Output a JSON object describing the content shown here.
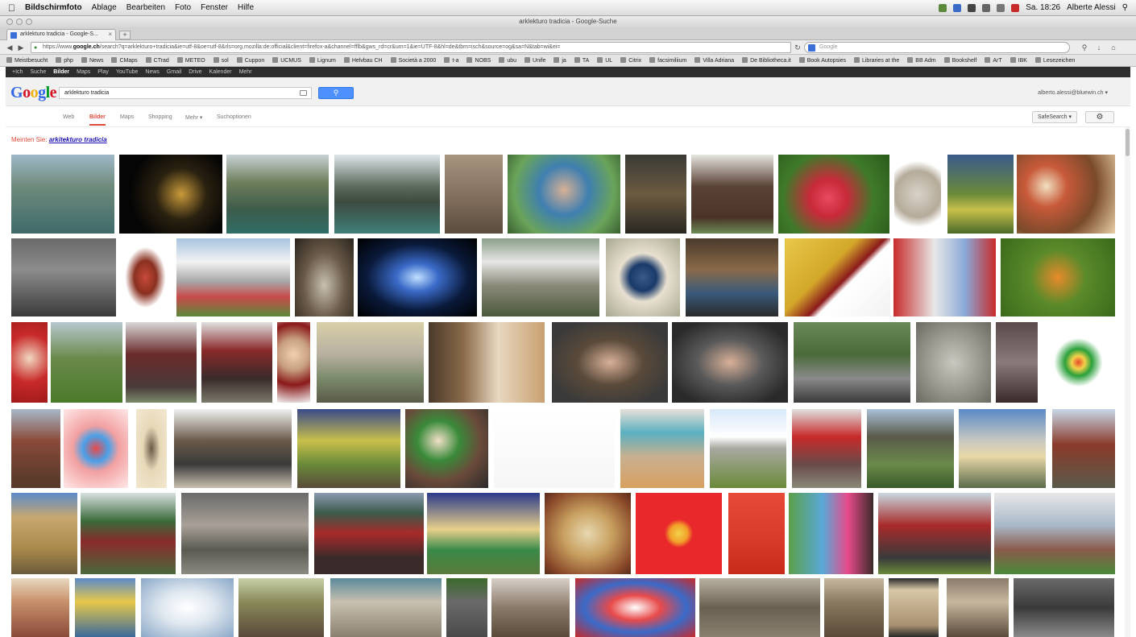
{
  "menubar": {
    "app": "Bildschirmfoto",
    "items": [
      "Ablage",
      "Bearbeiten",
      "Foto",
      "Fenster",
      "Hilfe"
    ],
    "clock": "Sa. 18:26",
    "user": "Alberte Alessi"
  },
  "window": {
    "title": "arklekturo tradicia - Google-Suche"
  },
  "browser": {
    "tab_title": "arklekturo tradicia - Google-S...",
    "url_prefix": "https://www.",
    "url_domain": "google.ch",
    "url_rest": "/search?q=arklekturo+tradicia&ie=utf-8&oe=utf-8&rls=org.mozilla:de:official&client=firefox-a&channel=fflb&gws_rd=cr&um=1&ie=UTF-8&hl=de&tbm=isch&source=og&sa=N&tab=wi&ei=",
    "search_placeholder": "Google"
  },
  "bookmarks": [
    "Meistbesucht",
    "php",
    "News",
    "CMaps",
    "CTrad",
    "METEO",
    "sol",
    "Cuppon",
    "UCMUS",
    "Lignum",
    "Helvbau CH",
    "Società a 2000",
    "t-a",
    "NOBS",
    "ubu",
    "Unife",
    "ja",
    "TA",
    "UL",
    "Citrix",
    "facsimiliium",
    "Villa Adriana",
    "De Bibliotheca.it",
    "Book Autopsies",
    "Libraries at the",
    "BB Adm",
    "Bookshelf",
    "ArT",
    "IBK",
    "Lesezeichen"
  ],
  "google_bar": [
    "+Ich",
    "Suche",
    "Bilder",
    "Maps",
    "Play",
    "YouTube",
    "News",
    "Gmail",
    "Drive",
    "Kalender",
    "Mehr"
  ],
  "google_bar_active": 2,
  "search": {
    "query": "arklekturo tradicia",
    "button_icon": "search-icon",
    "user_email": "alberto.alessi@bluewin.ch"
  },
  "tools": {
    "items": [
      "Web",
      "Bilder",
      "Maps",
      "Shopping",
      "Mehr",
      "Suchoptionen"
    ],
    "active": 1,
    "safe_search": "SafeSearch",
    "settings_icon": "gear-icon"
  },
  "did_you_mean": {
    "prefix": "Meinten Sie:",
    "suggestion": "arkitekturo tradicia"
  },
  "colors": {
    "accent_blue": "#4d90fe",
    "google_red": "#dd4b39",
    "link": "#1a0dab"
  },
  "thumbnails": [
    {
      "bg": "linear-gradient(180deg,#9fb8c8 0%,#6f8b7c 40%,#3f6a6a 100%)"
    },
    {
      "bg": "radial-gradient(circle at 60% 50%,#c99a3a 0%,#2a2110 35%,#050505 70%)"
    },
    {
      "bg": "linear-gradient(180deg,#c8d2d6 0%,#6f7f5d 35%,#3c5b4a 70%,#2f6e66 100%)"
    },
    {
      "bg": "linear-gradient(180deg,#dfe6ea 0%,#5b6b5d 40%,#3d4a40 60%,#3f7f78 100%)"
    },
    {
      "bg": "linear-gradient(180deg,#a89580 0%,#7d6a58 60%,#5a4c3f 100%)"
    },
    {
      "bg": "radial-gradient(circle at 50% 45%,#d8b095 0%,#3f7fb0 35%,#6aa45a 70%,#3a6030 100%)"
    },
    {
      "bg": "linear-gradient(180deg,#3b3a36 0%,#6b5b40 50%,#2a2722 100%)"
    },
    {
      "bg": "linear-gradient(180deg,#e6e6e0 0%,#5a4236 40%,#4a3428 80%,#6c8a55 100%)"
    },
    {
      "bg": "radial-gradient(circle at 45% 55%,#e84a5f 0%,#c82a3a 25%,#3f7a2a 60%,#2a5a1a 100%)"
    },
    {
      "bg": "radial-gradient(circle,#d8d2c8 0%,#b5ab9a 50%,#ffffff 72%)"
    },
    {
      "bg": "linear-gradient(180deg,#3a5a8a 0%,#6a8a3a 50%,#c8c04a 70%,#4a6a2a 100%)"
    },
    {
      "bg": "radial-gradient(circle at 30% 40%,#f0e0c0 0%,#c85a3a 25%,#7a4a2a 60%,#e8d0a8 100%)"
    },
    {
      "bg": "linear-gradient(180deg,#6a6a6a 0%,#8c8c8c 40%,#3a3a3a 100%)"
    },
    {
      "bg": "radial-gradient(ellipse at 50% 50%,#c84a3a 0%,#8a3020 30%,#ffffff 55%)"
    },
    {
      "bg": "linear-gradient(180deg,#a8c4e0 0%,#f2f2f2 30%,#a8a8a8 55%,#c84a4a 75%,#5a8a3a 100%)"
    },
    {
      "bg": "radial-gradient(ellipse at 50% 60%,#c8c0b0 0%,#6a5a48 50%,#2a241d 100%)"
    },
    {
      "bg": "radial-gradient(ellipse at 50% 50%,#c0e0ff 0%,#3a6ac8 25%,#0a1a3a 60%,#000000 100%)"
    },
    {
      "bg": "linear-gradient(180deg,#8aa08a 0%,#e6e6e6 30%,#8a8a7a 60%,#4a5a3a 100%)"
    },
    {
      "bg": "radial-gradient(circle at 50% 50%,#3a5a8a 0%,#1a3a6a 25%,#e8e0d0 45%,#a8a890 100%)"
    },
    {
      "bg": "linear-gradient(180deg,#4a3a2a 0%,#8a6a4a 40%,#3a5a7a 70%,#2a2a2a 100%)"
    },
    {
      "bg": "linear-gradient(135deg,#e8c84a 0%,#d4a82a 40%,#8a1a1a 55%,#ffffff 60%,#f2f2f2 100%)"
    },
    {
      "bg": "linear-gradient(90deg,#c82a2a 0%,#e8e8e8 40%,#8aa8d8 70%,#c82a2a 100%)"
    },
    {
      "bg": "radial-gradient(circle at 50% 50%,#e88a2a 0%,#5a8a2a 40%,#3a6a1a 100%)"
    },
    {
      "bg": "radial-gradient(circle at 50% 45%,#f0d8c0 0%,#c82a2a 50%,#a01a1a 100%)"
    },
    {
      "bg": "linear-gradient(180deg,#b8c8d0 0%,#6a8a4a 45%,#4a7a2a 100%)"
    },
    {
      "bg": "linear-gradient(180deg,#d8d8d8 0%,#6a2a2a 40%,#4a3a3a 80%,#7a8a6a 100%)"
    },
    {
      "bg": "linear-gradient(180deg,#e0e0e0 0%,#8a2a2a 35%,#3a2a2a 70%,#7a7a6a 100%)"
    },
    {
      "bg": "radial-gradient(circle at 50% 40%,#f0d0b0 0%,#c8a080 30%,#8a1a1a 60%,#f2f2f2 100%)"
    },
    {
      "bg": "linear-gradient(180deg,#d8d0a8 0%,#b8b0a0 40%,#7a8a6a 70%,#5a5a48 100%)"
    },
    {
      "bg": "linear-gradient(90deg,#4a3a2a 0%,#8a6a4a 30%,#e8d8c0 60%,#c8a070 100%)"
    },
    {
      "bg": "radial-gradient(ellipse at 50% 50%,#d8b098 0%,#5a4a3a 40%,#3a3a3a 80%)"
    },
    {
      "bg": "radial-gradient(ellipse at 50% 50%,#d8b098 0%,#5a5a5a 40%,#2a2a2a 80%)"
    },
    {
      "bg": "linear-gradient(180deg,#6a8a5a 0%,#4a6a3a 40%,#8a8a8a 70%,#3a3a3a 100%)"
    },
    {
      "bg": "radial-gradient(ellipse at 50% 50%,#c8c8c0 0%,#9a9a90 50%,#6a6a62 100%)"
    },
    {
      "bg": "linear-gradient(180deg,#5a4a4a 0%,#8a7a7a 50%,#3a2a2a 100%)"
    },
    {
      "bg": "radial-gradient(circle at 50% 50%,#e84a2a 0%,#f2d24a 12%,#2aa03a 25%,#ffffff 45%)"
    },
    {
      "bg": "linear-gradient(180deg,#a8b8c8 0%,#8a4a3a 40%,#5a3a2a 90%)"
    },
    {
      "bg": "radial-gradient(circle at 50% 50%,#e84a4a 0%,#4aa0e8 25%,#f2a0a0 45%,#ffe8e8 100%)"
    },
    {
      "bg": "radial-gradient(ellipse at 50% 50%,#6a5a48 0%,#e8d8b8 40%,#f2e8d0 100%)"
    },
    {
      "bg": "linear-gradient(180deg,#f0f0f0 0%,#6a5a4a 40%,#3a3a3a 70%,#c8c0b0 100%)"
    },
    {
      "bg": "linear-gradient(180deg,#3a4a8a 0%,#c8c04a 40%,#6a8a3a 70%,#5a4a3a 100%)"
    },
    {
      "bg": "radial-gradient(ellipse at 40% 40%,#f2e0c8 0%,#3a8a3a 30%,#6a4a3a 60%,#2a2a2a 100%)"
    },
    {
      "bg": "linear-gradient(180deg,#ffffff 0%,#f6f6f6 100%)"
    },
    {
      "bg": "linear-gradient(180deg,#e8e0d8 0%,#5ab0c0 30%,#c8b090 60%,#d8a060 100%)"
    },
    {
      "bg": "linear-gradient(180deg,#d8e8f8 0%,#ffffff 35%,#a8a8a0 50%,#6a8a3a 100%)"
    },
    {
      "bg": "linear-gradient(180deg,#e0e0e0 0%,#c82a2a 35%,#6a4a4a 70%,#8a8a7a 100%)"
    },
    {
      "bg": "linear-gradient(180deg,#a8c0d8 0%,#5a5a4a 35%,#6a8a4a 70%,#3a5a2a 100%)"
    },
    {
      "bg": "linear-gradient(180deg,#5a8ac8 0%,#c8c8c0 40%,#e8d8a8 60%,#5a6a4a 100%)"
    },
    {
      "bg": "linear-gradient(180deg,#c8d8e8 0%,#8a3a2a 45%,#5a5a4a 100%)"
    },
    {
      "bg": "linear-gradient(180deg,#5a8ac8 0%,#c8a870 30%,#a8884a 70%,#6a5a3a 100%)"
    },
    {
      "bg": "linear-gradient(180deg,#d8e0e0 0%,#3a6a3a 35%,#8a2a2a 60%,#4a6a3a 100%)"
    },
    {
      "bg": "linear-gradient(180deg,#6a6a6a 0%,#a8a098 40%,#5a5a52 70%,#8a8a82 100%)"
    },
    {
      "bg": "linear-gradient(180deg,#8a9ab0 0%,#3a5a4a 25%,#a82a2a 50%,#3a2a2a 80%)"
    },
    {
      "bg": "linear-gradient(180deg,#2a3a8a 0%,#e8d08a 45%,#3a8a4a 70%,#5a7a3a 100%)"
    },
    {
      "bg": "radial-gradient(ellipse at 50% 50%,#e8d8b0 0%,#c8a060 40%,#8a4a2a 80%,#5a2a1a 100%)"
    },
    {
      "bg": "radial-gradient(circle at 50% 50%,#f2d24a 0%,#f2a02a 15%,#e8282a 24%,#e8282a 100%)"
    },
    {
      "bg": "linear-gradient(180deg,#e84a3a 0%,#d83a2a 60%,#c82a1a 100%)"
    },
    {
      "bg": "linear-gradient(90deg,#5aa04a 0%,#5aa8d8 40%,#e84a8a 70%,#3a2a2a 100%)"
    },
    {
      "bg": "linear-gradient(180deg,#c8d8e0 0%,#a82a2a 40%,#3a3a3a 80%,#6a8a3a 100%)"
    },
    {
      "bg": "linear-gradient(180deg,#e8e8e8 0%,#a8b8c8 40%,#8a5a4a 70%,#4a8a3a 100%)"
    },
    {
      "bg": "linear-gradient(180deg,#e8d8c0 0%,#c8906a 40%,#8a4a3a 100%)"
    },
    {
      "bg": "linear-gradient(180deg,#5a8ac8 0%,#e8c84a 40%,#3a6a9a 100%)"
    },
    {
      "bg": "radial-gradient(ellipse at 50% 50%,#ffffff 0%,#e0e8f0 40%,#8aa8c8 100%)"
    },
    {
      "bg": "linear-gradient(180deg,#c8d0a8 0%,#8a8a5a 40%,#5a4a3a 100%)"
    },
    {
      "bg": "linear-gradient(180deg,#5a8a9a 0%,#c8c0b0 40%,#8a8070 100%)"
    },
    {
      "bg": "linear-gradient(180deg,#3a6a2a 0%,#6a6a6a 40%,#4a4a4a 100%)"
    },
    {
      "bg": "linear-gradient(180deg,#d8d0c8 0%,#8a7a6a 50%,#5a4a3a 100%)"
    },
    {
      "bg": "radial-gradient(ellipse at 50% 50%,#ffffff 0%,#e84a4a 30%,#3a6ac8 60%,#c82a2a 100%)"
    },
    {
      "bg": "linear-gradient(180deg,#b8b0a0 0%,#6a6052 50%,#8a8070 100%)"
    },
    {
      "bg": "linear-gradient(180deg,#c8b8a0 0%,#8a7a60 40%,#5a4a38 100%)"
    },
    {
      "bg": "linear-gradient(180deg,#2a2a2a 0%,#d8c8a8 20%,#a89070 80%,#2a2a2a 100%)"
    },
    {
      "bg": "linear-gradient(180deg,#8a7a6a 0%,#c8b8a0 40%,#5a4a3a 100%)"
    },
    {
      "bg": "linear-gradient(180deg,#6a6a6a 0%,#3a3a3a 50%,#8a8a8a 100%)"
    },
    {
      "bg": "linear-gradient(180deg,#e8e8e8 0%,#a8a8a8 50%,#f2f2f2 100%)"
    }
  ]
}
